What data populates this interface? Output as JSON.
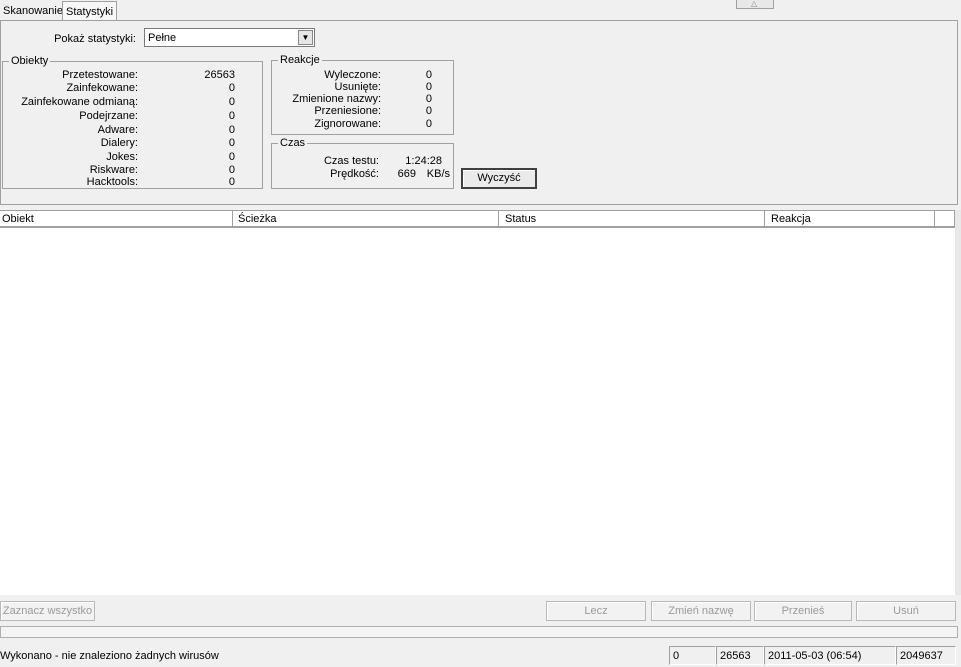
{
  "tabs": [
    {
      "label": "Skanowanie",
      "active": false
    },
    {
      "label": "Statystyki",
      "active": true
    }
  ],
  "show_stats": {
    "label": "Pokaż statystyki:",
    "selected": "Pełne"
  },
  "objects_group": {
    "title": "Obiekty",
    "rows": [
      {
        "label": "Przetestowane:",
        "value": "26563"
      },
      {
        "label": "Zainfekowane:",
        "value": "0"
      },
      {
        "label": "Zainfekowane odmianą:",
        "value": "0"
      },
      {
        "label": "Podejrzane:",
        "value": "0"
      },
      {
        "label": "Adware:",
        "value": "0"
      },
      {
        "label": "Dialery:",
        "value": "0"
      },
      {
        "label": "Jokes:",
        "value": "0"
      },
      {
        "label": "Riskware:",
        "value": "0"
      },
      {
        "label": "Hacktools:",
        "value": "0"
      }
    ]
  },
  "reactions_group": {
    "title": "Reakcje",
    "rows": [
      {
        "label": "Wyleczone:",
        "value": "0"
      },
      {
        "label": "Usunięte:",
        "value": "0"
      },
      {
        "label": "Zmienione nazwy:",
        "value": "0"
      },
      {
        "label": "Przeniesione:",
        "value": "0"
      },
      {
        "label": "Zignorowane:",
        "value": "0"
      }
    ]
  },
  "time_group": {
    "title": "Czas",
    "test_time_label": "Czas testu:",
    "test_time_value": "1:24:28",
    "speed_label": "Prędkość:",
    "speed_value": "669",
    "speed_unit": "KB/s"
  },
  "clear_button": "Wyczyść",
  "list": {
    "columns": [
      "Obiekt",
      "Ścieżka",
      "Status",
      "Reakcja"
    ]
  },
  "actions": {
    "select_all": "Zaznacz wszystko",
    "cure": "Lecz",
    "rename": "Zmień nazwę",
    "move": "Przenieś",
    "delete": "Usuń"
  },
  "status_bar": {
    "message": "Wykonano - nie znaleziono żadnych wirusów",
    "infected": "0",
    "scanned": "26563",
    "datetime": "2011-05-03 (06:54)",
    "size": "2049637"
  }
}
